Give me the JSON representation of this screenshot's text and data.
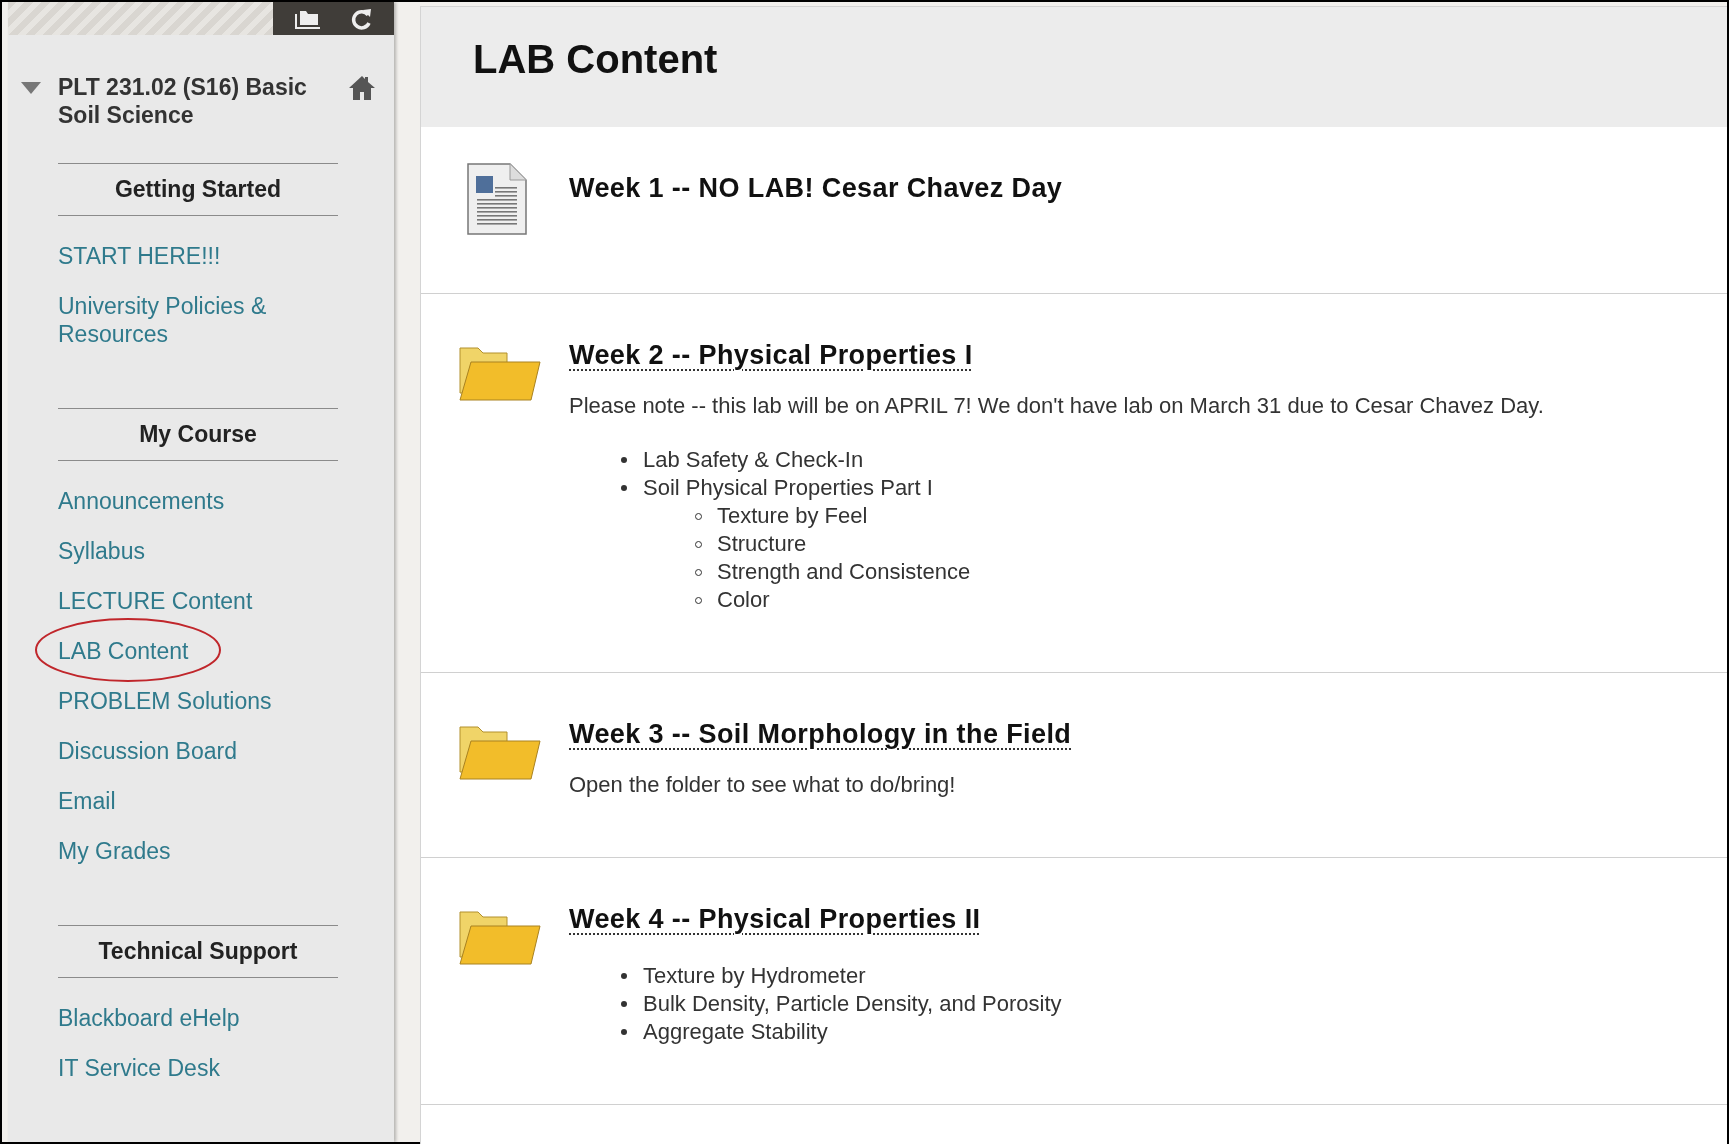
{
  "sidebar": {
    "course_title": "PLT 231.02 (S16) Basic Soil Science",
    "expanded": true,
    "sections": [
      {
        "heading": "Getting Started",
        "links": [
          {
            "label": "START HERE!!!",
            "circled": false
          },
          {
            "label": "University Policies & Resources",
            "circled": false
          }
        ]
      },
      {
        "heading": "My Course",
        "links": [
          {
            "label": "Announcements",
            "circled": false
          },
          {
            "label": "Syllabus",
            "circled": false
          },
          {
            "label": "LECTURE Content",
            "circled": false
          },
          {
            "label": "LAB Content",
            "circled": true
          },
          {
            "label": "PROBLEM Solutions",
            "circled": false
          },
          {
            "label": "Discussion Board",
            "circled": false
          },
          {
            "label": "Email",
            "circled": false
          },
          {
            "label": "My Grades",
            "circled": false
          }
        ]
      },
      {
        "heading": "Technical Support",
        "links": [
          {
            "label": "Blackboard eHelp",
            "circled": false
          },
          {
            "label": "IT Service Desk",
            "circled": false
          }
        ]
      }
    ]
  },
  "content": {
    "page_title": "LAB Content",
    "items": [
      {
        "kind": "document",
        "title": "Week 1 -- NO LAB! Cesar Chavez Day"
      },
      {
        "kind": "folder",
        "title": "Week 2 -- Physical Properties I",
        "description": "Please note -- this lab will be on APRIL 7!  We don't have lab on March 31 due to Cesar Chavez Day.",
        "bullets": [
          {
            "text": "Lab Safety & Check-In"
          },
          {
            "text": "Soil Physical Properties Part I",
            "children": [
              {
                "text": "Texture by Feel"
              },
              {
                "text": "Structure"
              },
              {
                "text": "Strength and Consistence"
              },
              {
                "text": "Color"
              }
            ]
          }
        ]
      },
      {
        "kind": "folder",
        "title": "Week 3 -- Soil Morphology in the Field",
        "description": "Open the folder to see what to do/bring!"
      },
      {
        "kind": "folder",
        "title": "Week 4 -- Physical Properties II",
        "bullets": [
          {
            "text": "Texture by Hydrometer"
          },
          {
            "text": "Bulk Density, Particle Density, and Porosity"
          },
          {
            "text": "Aggregate Stability"
          }
        ]
      }
    ]
  }
}
